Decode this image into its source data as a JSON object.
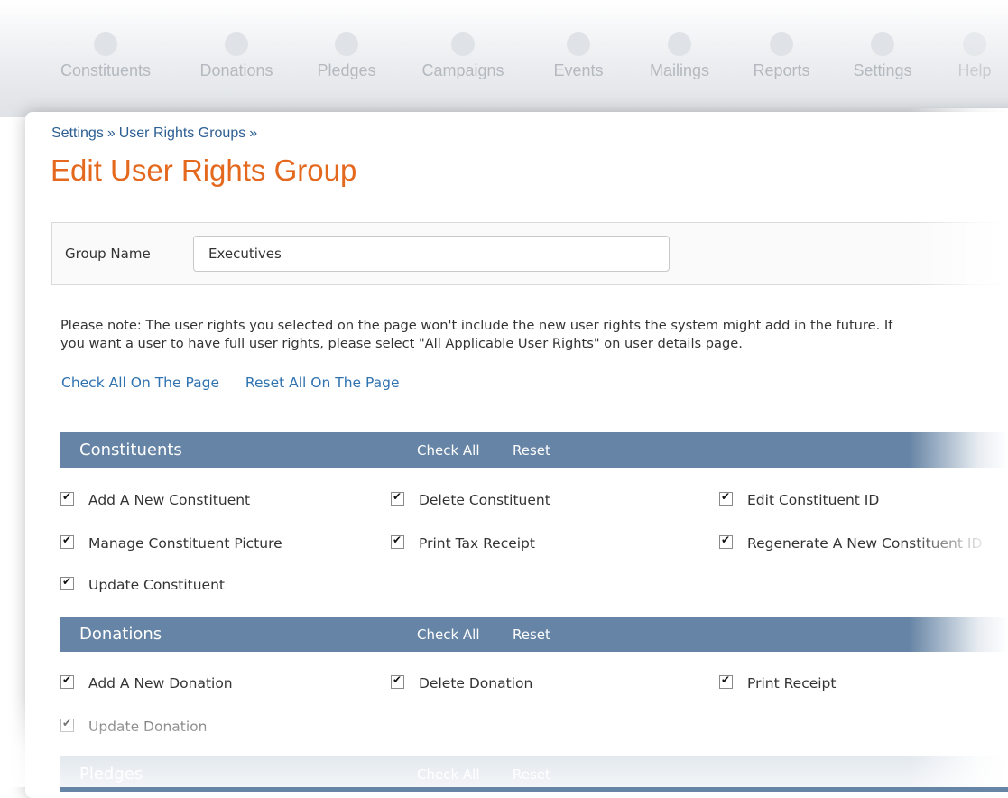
{
  "nav": {
    "items": [
      {
        "label": "Constituents",
        "icon": "people-icon"
      },
      {
        "label": "Donations",
        "icon": "donation-icon"
      },
      {
        "label": "Pledges",
        "icon": "pledge-icon"
      },
      {
        "label": "Campaigns",
        "icon": "campaign-icon"
      },
      {
        "label": "Events",
        "icon": "calendar-icon"
      },
      {
        "label": "Mailings",
        "icon": "mail-icon"
      },
      {
        "label": "Reports",
        "icon": "chart-icon"
      },
      {
        "label": "Settings",
        "icon": "gear-icon"
      },
      {
        "label": "Help",
        "icon": "help-icon"
      }
    ]
  },
  "breadcrumb": {
    "items": [
      "Settings",
      "User Rights Groups"
    ],
    "separator": "»"
  },
  "page_title": "Edit User Rights Group",
  "group": {
    "label": "Group Name",
    "value": "Executives"
  },
  "note": {
    "line1": "Please note: The user rights you selected on the page won't include the new user rights the system might add in the future. If",
    "line2": "you want a user to have full user rights, please select \"All Applicable User Rights\" on user details page."
  },
  "page_links": {
    "check_all": "Check All On The Page",
    "reset_all": "Reset All On The Page"
  },
  "sections": [
    {
      "title": "Constituents",
      "check_all": "Check All",
      "reset": "Reset",
      "rights": [
        {
          "label": "Add A New Constituent",
          "checked": true
        },
        {
          "label": "Delete Constituent",
          "checked": true
        },
        {
          "label": "Edit Constituent ID",
          "checked": true
        },
        {
          "label": "Manage Constituent Picture",
          "checked": true
        },
        {
          "label": "Print Tax Receipt",
          "checked": true
        },
        {
          "label": "Regenerate A New Constituent ID",
          "checked": true
        },
        {
          "label": "Update Constituent",
          "checked": true
        }
      ]
    },
    {
      "title": "Donations",
      "check_all": "Check All",
      "reset": "Reset",
      "rights": [
        {
          "label": "Add A New Donation",
          "checked": true
        },
        {
          "label": "Delete Donation",
          "checked": true
        },
        {
          "label": "Print Receipt",
          "checked": true
        },
        {
          "label": "Update Donation",
          "checked": true
        }
      ]
    },
    {
      "title": "Pledges",
      "check_all": "Check All",
      "reset": "Reset",
      "rights": []
    }
  ],
  "colors": {
    "accent_orange": "#e4691f",
    "section_bar": "#6684a5",
    "link_blue": "#2f72b0"
  }
}
